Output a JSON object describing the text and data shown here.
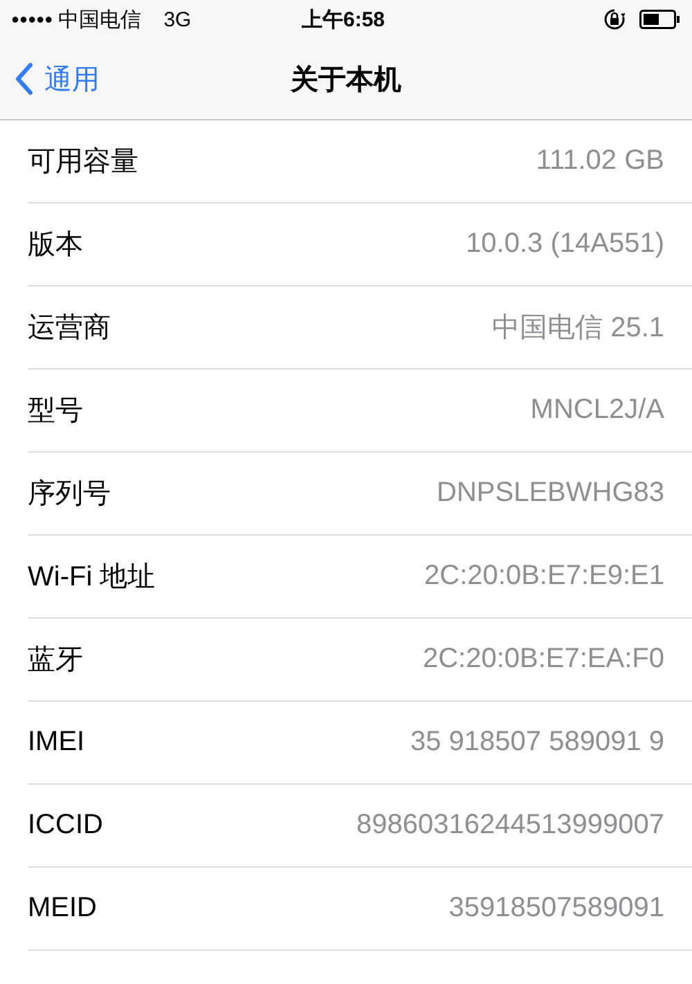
{
  "status_bar": {
    "signal_dots": "●●●●●",
    "carrier": "中国电信",
    "network": "3G",
    "time": "上午6:58"
  },
  "nav_bar": {
    "back_label": "通用",
    "title": "关于本机"
  },
  "rows": [
    {
      "label": "可用容量",
      "value": "111.02 GB"
    },
    {
      "label": "版本",
      "value": "10.0.3 (14A551)"
    },
    {
      "label": "运营商",
      "value": "中国电信 25.1"
    },
    {
      "label": "型号",
      "value": "MNCL2J/A"
    },
    {
      "label": "序列号",
      "value": "DNPSLEBWHG83"
    },
    {
      "label": "Wi-Fi 地址",
      "value": "2C:20:0B:E7:E9:E1"
    },
    {
      "label": "蓝牙",
      "value": "2C:20:0B:E7:EA:F0"
    },
    {
      "label": "IMEI",
      "value": "35 918507 589091 9"
    },
    {
      "label": "ICCID",
      "value": "89860316244513999007"
    },
    {
      "label": "MEID",
      "value": "35918507589091"
    }
  ]
}
